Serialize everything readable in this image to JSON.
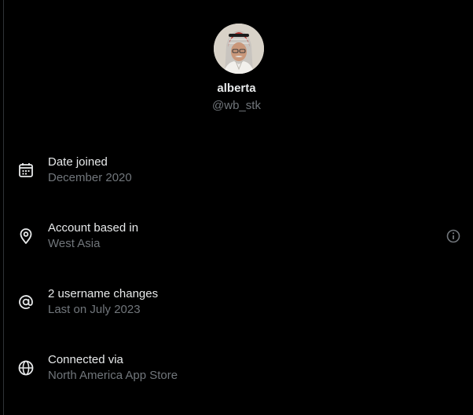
{
  "profile": {
    "display_name": "alberta",
    "handle": "@wb_stk"
  },
  "details": [
    {
      "icon": "calendar-icon",
      "title": "Date joined",
      "value": "December 2020"
    },
    {
      "icon": "location-pin-icon",
      "title": "Account based in",
      "value": "West Asia"
    },
    {
      "icon": "at-sign-icon",
      "title": "2 username changes",
      "value": "Last on July 2023"
    },
    {
      "icon": "globe-icon",
      "title": "Connected via",
      "value": "North America App Store"
    }
  ],
  "colors": {
    "background": "#000000",
    "primary_text": "#e7e9ea",
    "secondary_text": "#71767b"
  }
}
